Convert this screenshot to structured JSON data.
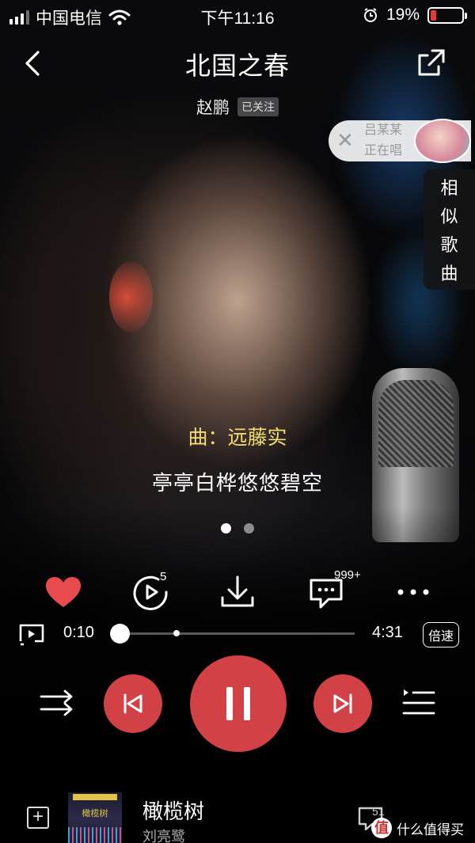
{
  "status_bar": {
    "carrier": "中国电信",
    "time": "下午11:16",
    "battery_percent": "19%",
    "battery_level": 0.19,
    "icons": [
      "signal-icon",
      "wifi-icon",
      "alarm-icon",
      "battery-icon"
    ]
  },
  "header": {
    "title": "北国之春",
    "artist": "赵鹏",
    "follow_badge": "已关注"
  },
  "live_card": {
    "names_text": "吕某某",
    "status_text": "正在唱"
  },
  "similar_songs_tab": [
    "相",
    "似",
    "歌",
    "曲"
  ],
  "lyrics": {
    "credit": "曲：远藤实",
    "current_line": "亭亭白桦悠悠碧空"
  },
  "pager": {
    "count": 2,
    "active": 0
  },
  "actions": {
    "replay_count": "5",
    "comment_count": "999+"
  },
  "playback": {
    "elapsed": "0:10",
    "duration": "4:31",
    "progress": 0.037,
    "buffered": 0.27,
    "speed_label": "倍速"
  },
  "mini_player": {
    "song": "橄榄树",
    "singer": "刘亮鹭",
    "cover_text": "橄榄树",
    "comment_count": "51"
  },
  "watermark": {
    "text": "什么值得买",
    "logo": "值"
  },
  "colors": {
    "accent": "#d24146",
    "lyric_credit": "#f4dd72",
    "like": "#e84a4e"
  }
}
